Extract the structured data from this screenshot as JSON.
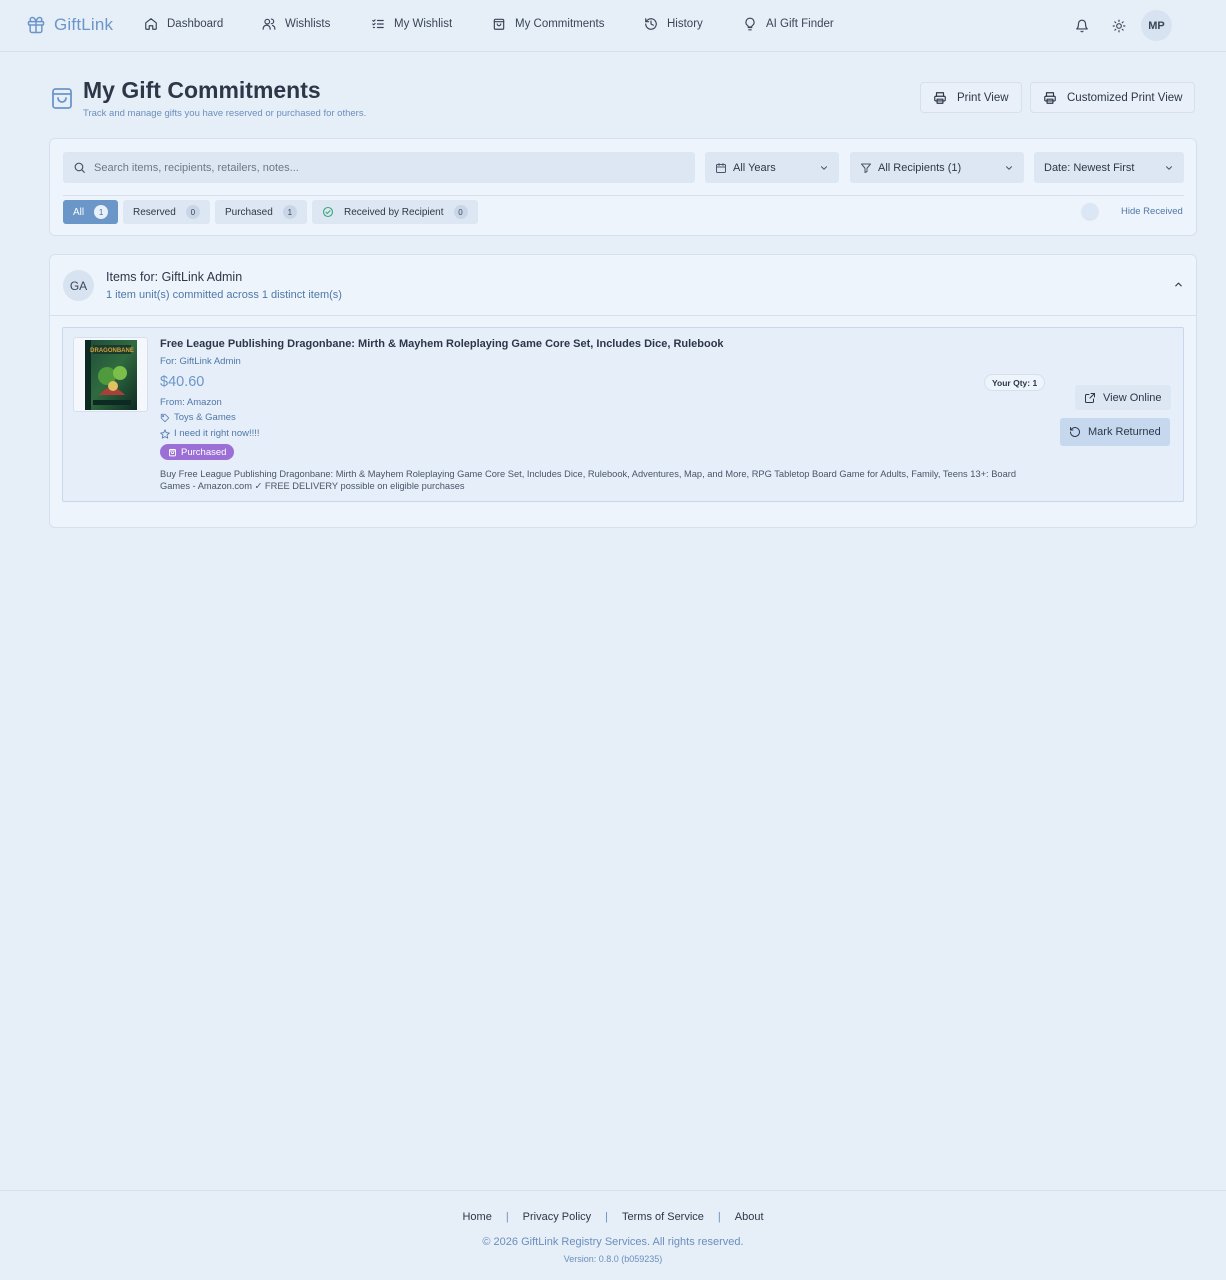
{
  "nav": {
    "brand": "GiftLink",
    "items": [
      {
        "label": "Dashboard",
        "icon": "home-icon"
      },
      {
        "label": "Wishlists",
        "icon": "users-icon"
      },
      {
        "label": "My Wishlist",
        "icon": "list-check-icon"
      },
      {
        "label": "My Commitments",
        "icon": "shopping-bag-icon"
      },
      {
        "label": "History",
        "icon": "history-icon"
      },
      {
        "label": "AI Gift Finder",
        "icon": "lightbulb-icon"
      }
    ],
    "user_initials": "MP"
  },
  "header": {
    "title": "My Gift Commitments",
    "subtitle": "Track and manage gifts you have reserved or purchased for others.",
    "print_view": "Print View",
    "custom_print_view": "Customized Print View"
  },
  "filters": {
    "search_placeholder": "Search items, recipients, retailers, notes...",
    "year": "All Years",
    "recipients": "All Recipients (1)",
    "sort": "Date: Newest First",
    "status_tabs": [
      {
        "label": "All",
        "count": "1",
        "active": true
      },
      {
        "label": "Reserved",
        "count": "0"
      },
      {
        "label": "Purchased",
        "count": "1"
      },
      {
        "label": "Received by Recipient",
        "count": "0"
      }
    ],
    "hide_received": "Hide Received"
  },
  "group": {
    "initials": "GA",
    "title": "Items for: GiftLink Admin",
    "subtitle": "1 item unit(s) committed across 1 distinct item(s)",
    "items": [
      {
        "title": "Free League Publishing Dragonbane: Mirth & Mayhem Roleplaying Game Core Set, Includes Dice, Rulebook",
        "for": "For: GiftLink Admin",
        "price": "$40.60",
        "from": "From: Amazon",
        "category": "Toys & Games",
        "note": "I need it right now!!!!",
        "status": "Purchased",
        "qty": "Your Qty: 1",
        "description": "Buy Free League Publishing Dragonbane: Mirth & Mayhem Roleplaying Game Core Set, Includes Dice, Rulebook, Adventures, Map, and More, RPG Tabletop Board Game for Adults, Family, Teens 13+: Board Games - Amazon.com ✓ FREE DELIVERY possible on eligible purchases",
        "view_online": "View Online",
        "mark_returned": "Mark Returned",
        "cover_text": "DRAGONBANE"
      }
    ]
  },
  "footer": {
    "links": [
      "Home",
      "Privacy Policy",
      "Terms of Service",
      "About"
    ],
    "separator": "|",
    "copyright": "© 2026 GiftLink Registry Services. All rights reserved.",
    "version": "Version: 0.8.0 (b059235)"
  },
  "colors": {
    "accent": "#6b96c8",
    "purchased": "#9b6fd6",
    "background": "#e6eef8"
  }
}
